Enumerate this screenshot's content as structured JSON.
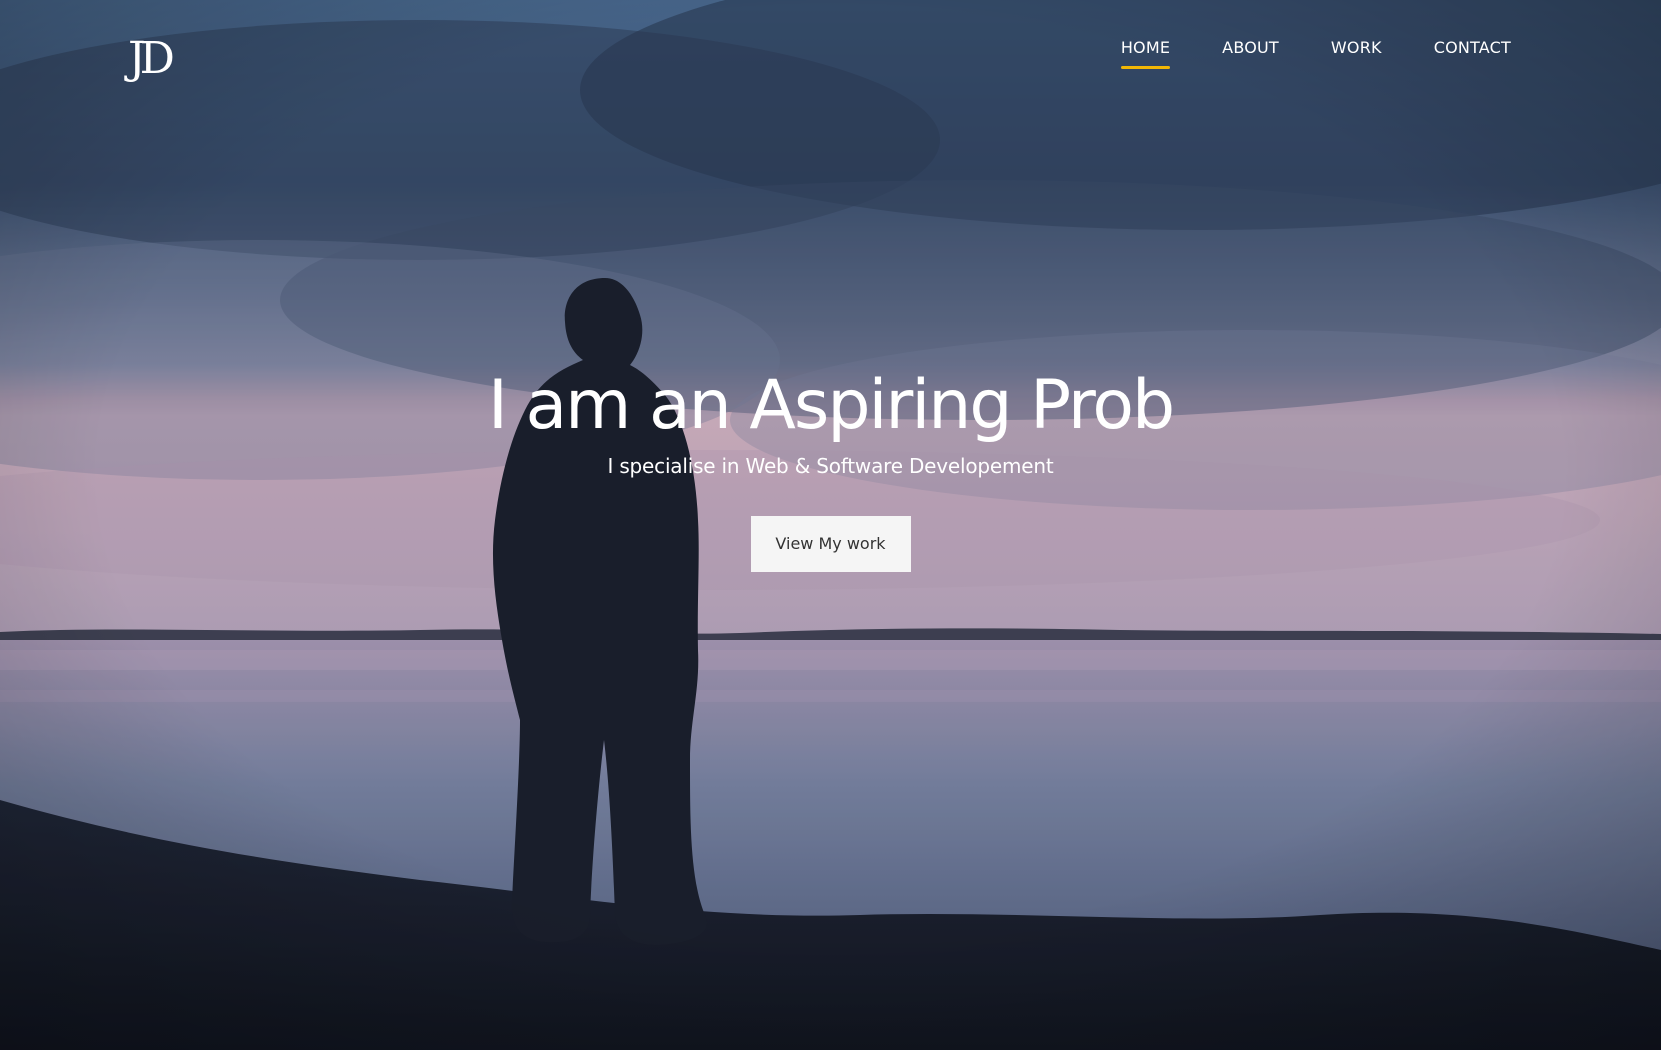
{
  "header": {
    "logo_text": "JD",
    "nav": [
      {
        "label": "HOME",
        "active": true
      },
      {
        "label": "ABOUT",
        "active": false
      },
      {
        "label": "WORK",
        "active": false
      },
      {
        "label": "CONTACT",
        "active": false
      }
    ]
  },
  "hero": {
    "headline": "I am an Aspiring Prob",
    "subtitle": "I specialise in Web & Software Developement",
    "cta_label": "View My work"
  },
  "colors": {
    "accent": "#f2b705",
    "text": "#ffffff",
    "button_bg": "#f5f5f5",
    "button_text": "#333333"
  }
}
